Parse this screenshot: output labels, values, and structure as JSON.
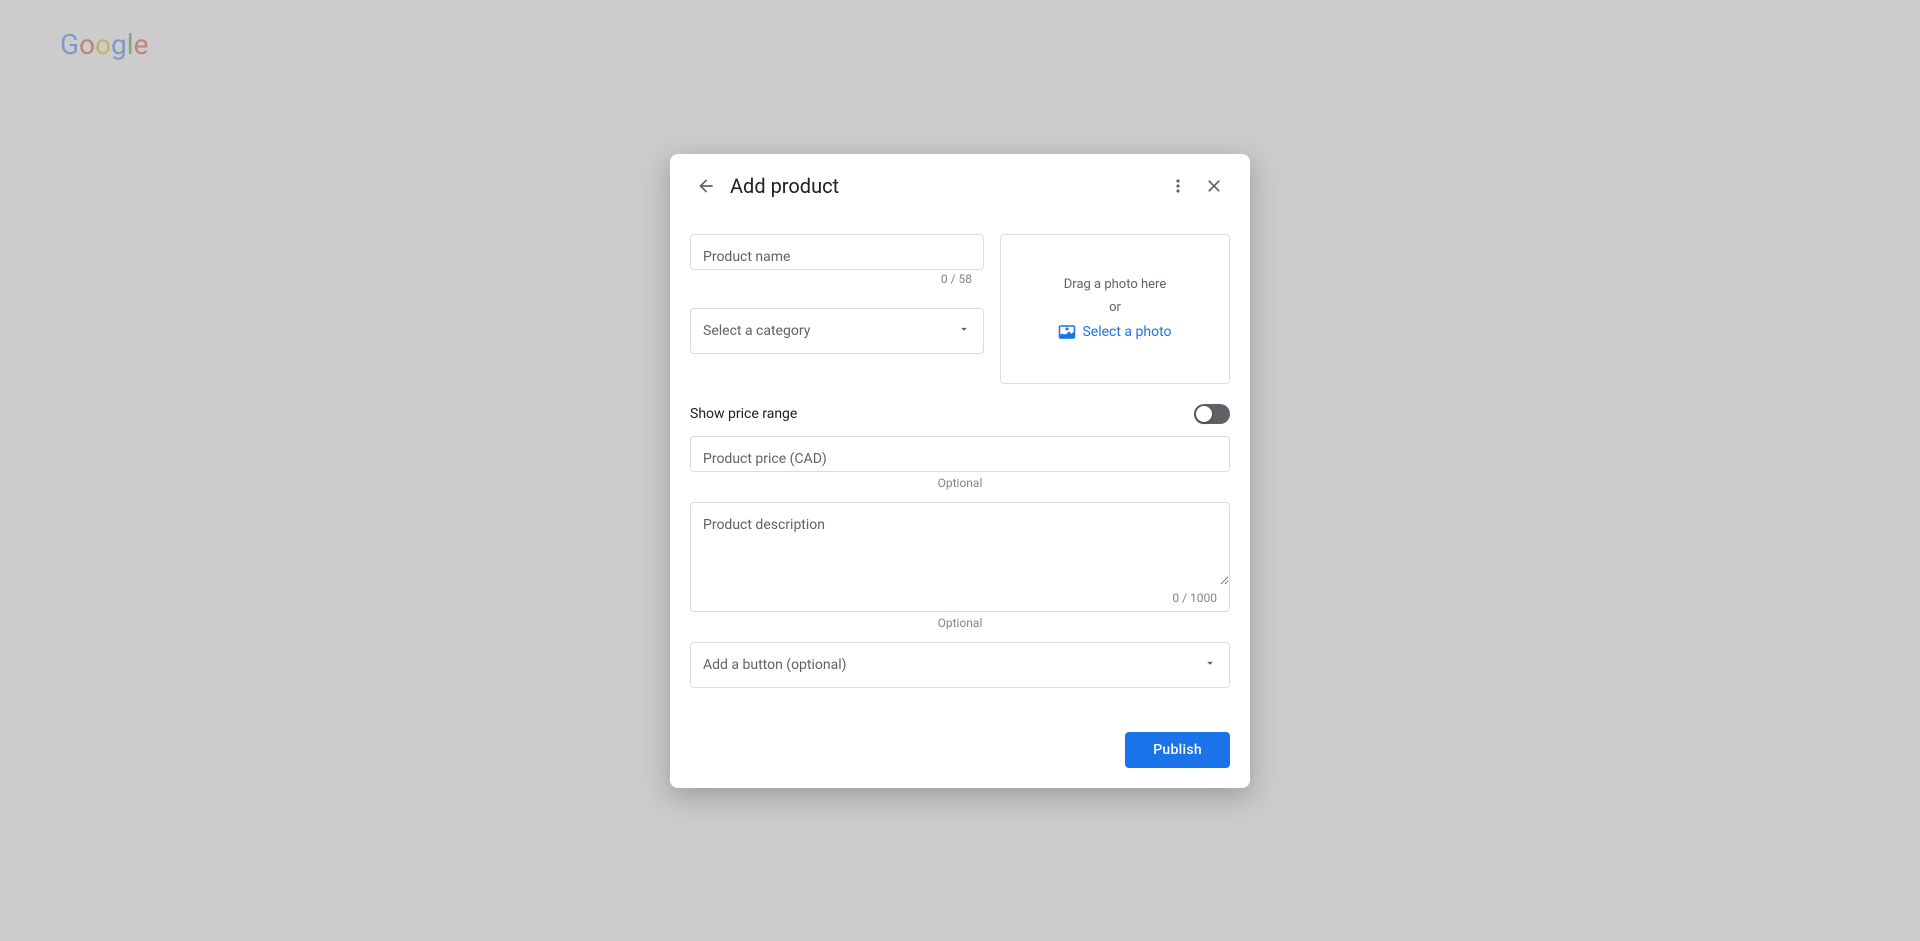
{
  "dialog": {
    "title": "Add product",
    "back_label": "back",
    "more_label": "more options",
    "close_label": "close"
  },
  "form": {
    "product_name": {
      "placeholder": "Product name",
      "counter": "0 / 58"
    },
    "category": {
      "placeholder": "Select a category",
      "options": [
        "Select a category"
      ]
    },
    "photo": {
      "drag_text": "Drag a photo here",
      "or_text": "or",
      "select_label": "Select a photo"
    },
    "show_price_range": {
      "label": "Show price range",
      "enabled": false
    },
    "product_price": {
      "placeholder": "Product price (CAD)",
      "optional_label": "Optional"
    },
    "product_description": {
      "placeholder": "Product description",
      "counter": "0 / 1000",
      "optional_label": "Optional"
    },
    "add_button": {
      "placeholder": "Add a button (optional)",
      "options": [
        "Add a button (optional)"
      ]
    }
  },
  "footer": {
    "publish_label": "Publish"
  }
}
